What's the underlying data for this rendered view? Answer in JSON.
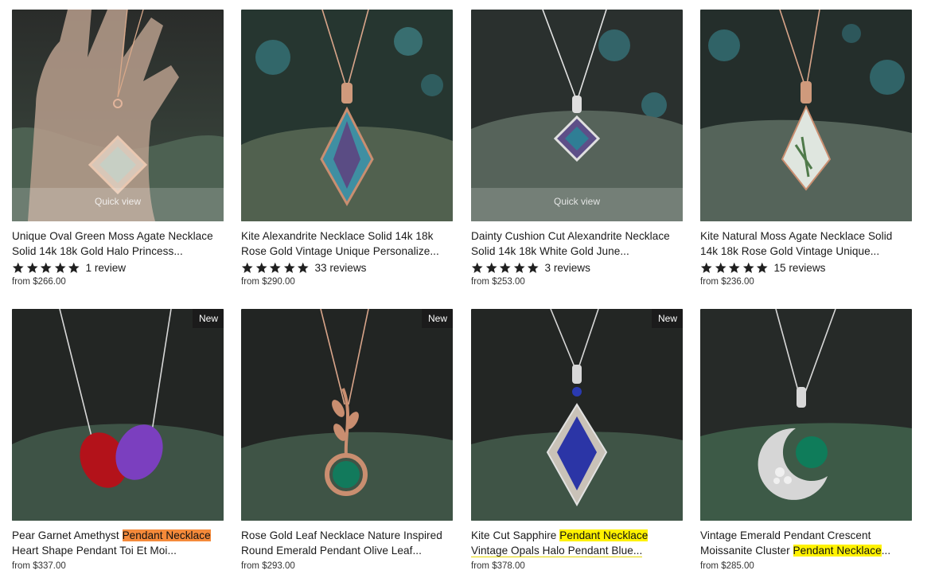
{
  "products": [
    {
      "title_line1": "Unique Oval Green Moss Agate Necklace",
      "title_line2": "Solid 14k 18k Gold Halo Princess...",
      "rating_text": "1 review",
      "stars": 5,
      "price": "from $266.00",
      "badge": "",
      "quick_view": "Quick view",
      "image": "moss-agate-oval-halo-on-hand"
    },
    {
      "title_line1": "Kite Alexandrite Necklace Solid 14k 18k",
      "title_line2": "Rose Gold Vintage Unique Personalize...",
      "rating_text": "33 reviews",
      "stars": 5,
      "price": "from $290.00",
      "badge": "",
      "quick_view": "",
      "image": "kite-alexandrite-pendant"
    },
    {
      "title_line1": "Dainty Cushion Cut Alexandrite Necklace",
      "title_line2": "Solid 14k 18k White Gold June...",
      "rating_text": "3 reviews",
      "stars": 5,
      "price": "from $253.00",
      "badge": "",
      "quick_view": "Quick view",
      "image": "cushion-alexandrite-pendant"
    },
    {
      "title_line1": "Kite Natural Moss Agate Necklace Solid",
      "title_line2": "14k 18k Rose Gold Vintage Unique...",
      "rating_text": "15 reviews",
      "stars": 5,
      "price": "from $236.00",
      "badge": "",
      "quick_view": "",
      "image": "kite-moss-agate-pendant"
    },
    {
      "title_line1_pre": "Pear Garnet Amethyst ",
      "title_line1_hl": "Pendant Necklace",
      "title_line2": "Heart Shape Pendant Toi Et Moi...",
      "price": "from $337.00",
      "badge": "New",
      "image": "garnet-amethyst-toi-et-moi"
    },
    {
      "title_line1": "Rose Gold Leaf Necklace Nature Inspired",
      "title_line2": "Round Emerald Pendant Olive Leaf...",
      "price": "from $293.00",
      "badge": "New",
      "image": "emerald-leaf-pendant"
    },
    {
      "title_line1_pre": "Kite Cut Sapphire ",
      "title_line1_hl": "Pendant Necklace",
      "title_line2": "Vintage Opals Halo Pendant Blue...",
      "price": "from $378.00",
      "badge": "New",
      "image": "kite-sapphire-opal-halo"
    },
    {
      "title_line1": "Vintage Emerald Pendant Crescent",
      "title_line2_pre": "Moissanite Cluster ",
      "title_line2_hl": "Pendant Necklace",
      "title_line2_post": "...",
      "price": "from $285.00",
      "badge": "",
      "image": "emerald-crescent-moon"
    }
  ],
  "colors": {
    "highlight_orange": "#f58a3a",
    "highlight_yellow": "#fff200",
    "badge_bg": "#1b1b1b",
    "star": "#1f1f1f"
  }
}
